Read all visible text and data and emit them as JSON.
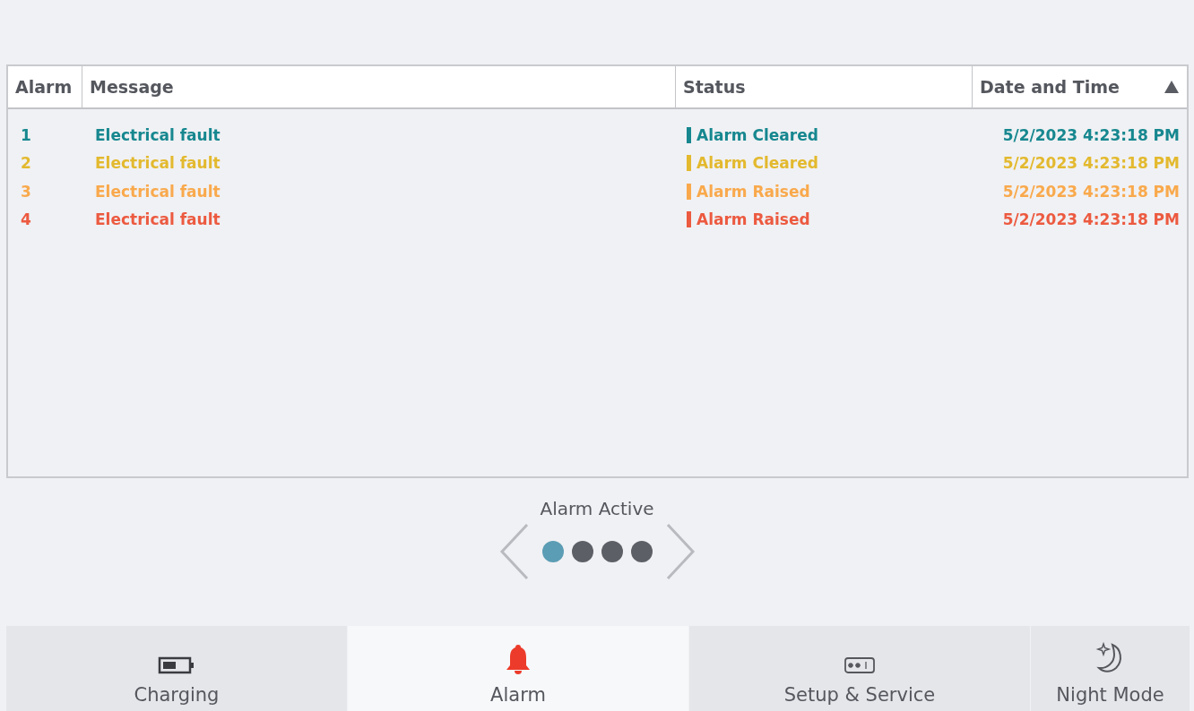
{
  "table": {
    "columns": [
      {
        "label": "Alarm"
      },
      {
        "label": "Message"
      },
      {
        "label": "Status"
      },
      {
        "label": "Date and Time",
        "sorted": true
      }
    ],
    "rows": [
      {
        "alarm": "1",
        "message": "Electrical fault",
        "status": "Alarm Cleared",
        "datetime": "5/2/2023 4:23:18 PM",
        "color": "#16878f"
      },
      {
        "alarm": "2",
        "message": "Electrical fault",
        "status": "Alarm Cleared",
        "datetime": "5/2/2023 4:23:18 PM",
        "color": "#e3b92e"
      },
      {
        "alarm": "3",
        "message": "Electrical fault",
        "status": "Alarm Raised",
        "datetime": "5/2/2023 4:23:18 PM",
        "color": "#f9a94c"
      },
      {
        "alarm": "4",
        "message": "Electrical fault",
        "status": "Alarm Raised",
        "datetime": "5/2/2023 4:23:18 PM",
        "color": "#ec5a40"
      }
    ]
  },
  "pager": {
    "label": "Alarm Active",
    "pages": [
      {
        "selected": true
      },
      {
        "selected": false
      },
      {
        "selected": false
      },
      {
        "selected": false
      }
    ]
  },
  "nav": [
    {
      "label": "Charging",
      "kind": "battery",
      "selected": false
    },
    {
      "label": "Alarm",
      "kind": "bell",
      "selected": true
    },
    {
      "label": "Setup & Service",
      "kind": "keypad",
      "selected": false
    },
    {
      "label": "Night Mode",
      "kind": "moon",
      "selected": false
    }
  ]
}
